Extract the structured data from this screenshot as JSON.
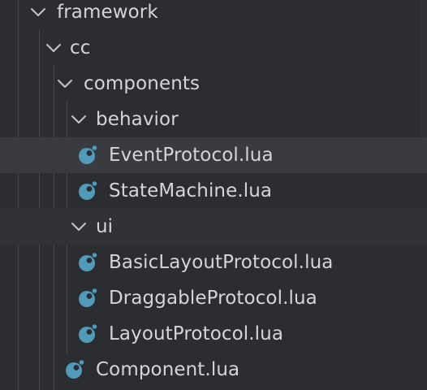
{
  "explorer": {
    "items": [
      {
        "label": "framework",
        "kind": "folder",
        "expanded": true,
        "depth": 0,
        "selected": false,
        "hover": false,
        "icon": "chevron-down-icon"
      },
      {
        "label": "cc",
        "kind": "folder",
        "expanded": true,
        "depth": 1,
        "selected": false,
        "hover": false,
        "icon": "chevron-down-icon"
      },
      {
        "label": "components",
        "kind": "folder",
        "expanded": true,
        "depth": 2,
        "selected": false,
        "hover": false,
        "icon": "chevron-down-icon"
      },
      {
        "label": "behavior",
        "kind": "folder",
        "expanded": true,
        "depth": 3,
        "selected": false,
        "hover": false,
        "icon": "chevron-down-icon"
      },
      {
        "label": "EventProtocol.lua",
        "kind": "file",
        "depth": 4,
        "selected": true,
        "hover": false,
        "icon": "lua-file-icon"
      },
      {
        "label": "StateMachine.lua",
        "kind": "file",
        "depth": 4,
        "selected": false,
        "hover": false,
        "icon": "lua-file-icon"
      },
      {
        "label": "ui",
        "kind": "folder",
        "expanded": true,
        "depth": 3,
        "selected": false,
        "hover": true,
        "icon": "chevron-down-icon"
      },
      {
        "label": "BasicLayoutProtocol.lua",
        "kind": "file",
        "depth": 4,
        "selected": false,
        "hover": false,
        "icon": "lua-file-icon"
      },
      {
        "label": "DraggableProtocol.lua",
        "kind": "file",
        "depth": 4,
        "selected": false,
        "hover": false,
        "icon": "lua-file-icon"
      },
      {
        "label": "LayoutProtocol.lua",
        "kind": "file",
        "depth": 4,
        "selected": false,
        "hover": false,
        "icon": "lua-file-icon"
      },
      {
        "label": "Component.lua",
        "kind": "file",
        "depth": 3,
        "selected": false,
        "hover": false,
        "icon": "lua-file-icon"
      }
    ]
  },
  "colors": {
    "background": "#2b2d31",
    "selected_row": "#393b40",
    "hover_row": "#303236",
    "text": "#d4d5d7",
    "twisty": "#c5c6c8",
    "lua_icon": "#519aba",
    "indent_guide": "#43464b"
  }
}
